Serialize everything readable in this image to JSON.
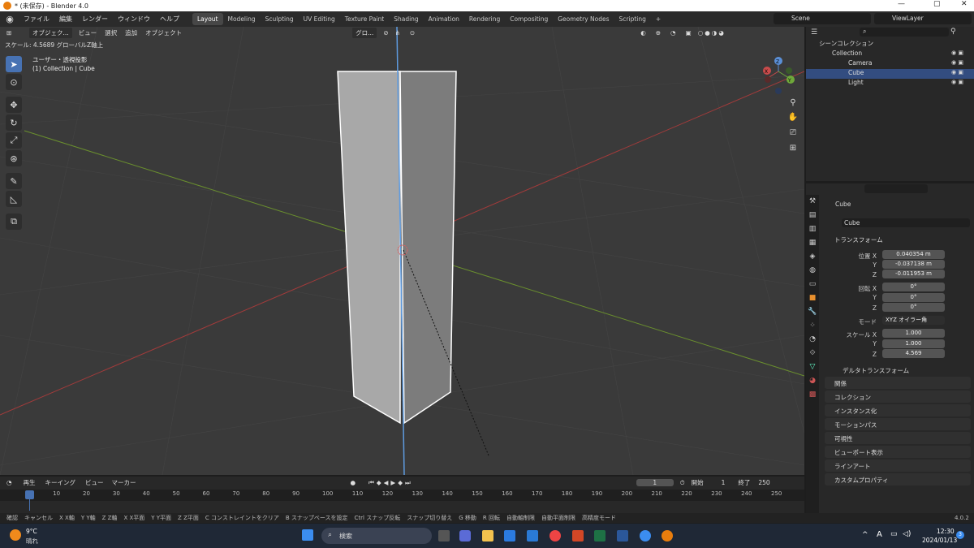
{
  "window": {
    "title": "* (未保存) - Blender 4.0",
    "min": "—",
    "max": "▢",
    "close": "✕"
  },
  "menu": [
    "ファイル",
    "編集",
    "レンダー",
    "ウィンドウ",
    "ヘルプ"
  ],
  "workspaces": [
    "Layout",
    "Modeling",
    "Sculpting",
    "UV Editing",
    "Texture Paint",
    "Shading",
    "Animation",
    "Rendering",
    "Compositing",
    "Geometry Nodes",
    "Scripting",
    "+"
  ],
  "scene": "Scene",
  "viewlayer": "ViewLayer",
  "viewport": {
    "mode": "オブジェク...",
    "menus": [
      "ビュー",
      "選択",
      "追加",
      "オブジェクト"
    ],
    "orientation": "グロ...",
    "operator_status": "スケール: 4.5689 グローバルZ軸上",
    "view_name": "ユーザー・透視投影",
    "collection_info": "(1) Collection | Cube",
    "gizmo": {
      "x": "X",
      "y": "Y",
      "z": "Z"
    }
  },
  "outliner": {
    "search_placeholder": "",
    "scene_collection": "シーンコレクション",
    "collection": "Collection",
    "items": [
      "Camera",
      "Cube",
      "Light"
    ]
  },
  "properties": {
    "object_name": "Cube",
    "datablock": "Cube",
    "transform_title": "トランスフォーム",
    "location_label": "位置 X",
    "location": [
      "0.040354 m",
      "-0.037138 m",
      "-0.011953 m"
    ],
    "rotation_label": "回転 X",
    "rotation": [
      "0°",
      "0°",
      "0°"
    ],
    "mode_label": "モード",
    "mode_value": "XYZ オイラー角",
    "scale_label": "スケール X",
    "scale": [
      "1.000",
      "1.000",
      "4.569"
    ],
    "axis_y": "Y",
    "axis_z": "Z",
    "delta": "デルタトランスフォーム",
    "panels": [
      "関係",
      "コレクション",
      "インスタンス化",
      "モーションパス",
      "可視性",
      "ビューポート表示",
      "ラインアート",
      "カスタムプロパティ"
    ]
  },
  "timeline": {
    "menus": [
      "再生",
      "キーイング",
      "ビュー",
      "マーカー"
    ],
    "current_frame": "1",
    "start_label": "開始",
    "start": "1",
    "end_label": "終了",
    "end": "250",
    "ticks": [
      "1",
      "10",
      "20",
      "30",
      "40",
      "50",
      "60",
      "70",
      "80",
      "90",
      "100",
      "110",
      "120",
      "130",
      "140",
      "150",
      "160",
      "170",
      "180",
      "190",
      "200",
      "210",
      "220",
      "230",
      "240",
      "250"
    ]
  },
  "statusbar": [
    "確認",
    "キャンセル",
    "X X軸",
    "Y Y軸",
    "Z Z軸",
    "X X平面",
    "Y Y平面",
    "Z Z平面",
    "C コンストレイントをクリア",
    "B スナップベースを設定",
    "Ctrl スナップ反転",
    "スナップ切り替え",
    "G 移動",
    "R 回転",
    "自動軸制限",
    "自動平面制限",
    "高精度モード"
  ],
  "version": "4.0.2",
  "taskbar": {
    "temp": "9°C",
    "weather": "晴れ",
    "search": "検索",
    "time": "12:30",
    "date": "2024/01/13",
    "ime": "A",
    "notif": "3"
  }
}
